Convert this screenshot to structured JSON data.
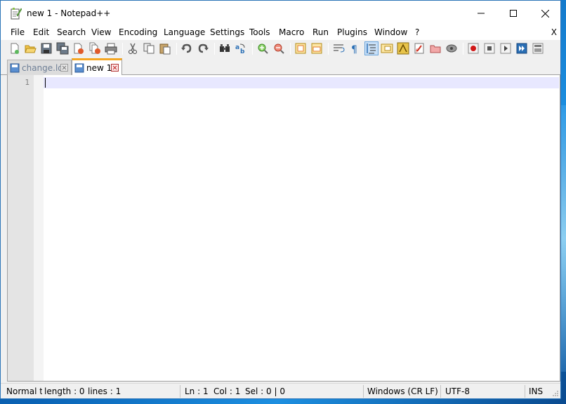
{
  "window": {
    "title": "new 1 - Notepad++"
  },
  "menu": {
    "items": [
      "File",
      "Edit",
      "Search",
      "View",
      "Encoding",
      "Language",
      "Settings",
      "Tools",
      "Macro",
      "Run",
      "Plugins",
      "Window",
      "?"
    ],
    "close_doc": "X"
  },
  "toolbar": {
    "buttons": [
      "new-file-icon",
      "open-file-icon",
      "save-icon",
      "save-all-icon",
      "close-icon",
      "close-all-icon",
      "print-icon",
      "cut-icon",
      "copy-icon",
      "paste-icon",
      "undo-icon",
      "redo-icon",
      "find-icon",
      "replace-icon",
      "zoom-in-icon",
      "zoom-out-icon",
      "sync-vertical-icon",
      "sync-horizontal-icon",
      "word-wrap-icon",
      "show-all-chars-icon",
      "indent-guide-icon",
      "user-defined-language-icon",
      "document-map-icon",
      "function-list-icon",
      "folder-as-workspace-icon",
      "monitoring-icon",
      "macro-record-icon",
      "macro-stop-icon",
      "macro-play-icon",
      "macro-run-multiple-icon",
      "macro-save-icon"
    ],
    "active_button": "indent-guide-icon"
  },
  "tabs": [
    {
      "label": "change.log",
      "active": false
    },
    {
      "label": "new 1",
      "active": true
    }
  ],
  "editor": {
    "line_numbers": [
      "1"
    ],
    "content": ""
  },
  "status": {
    "doc_type": "Normal text file",
    "length": "length : 0",
    "lines": "lines : 1",
    "ln": "Ln : 1",
    "col": "Col : 1",
    "sel": "Sel : 0 | 0",
    "eol": "Windows (CR LF)",
    "encoding": "UTF-8",
    "mode": "INS"
  },
  "colors": {
    "active_tab_accent": "#f5a623",
    "current_line": "#e8e8ff",
    "window_border": "#2b74b8"
  }
}
